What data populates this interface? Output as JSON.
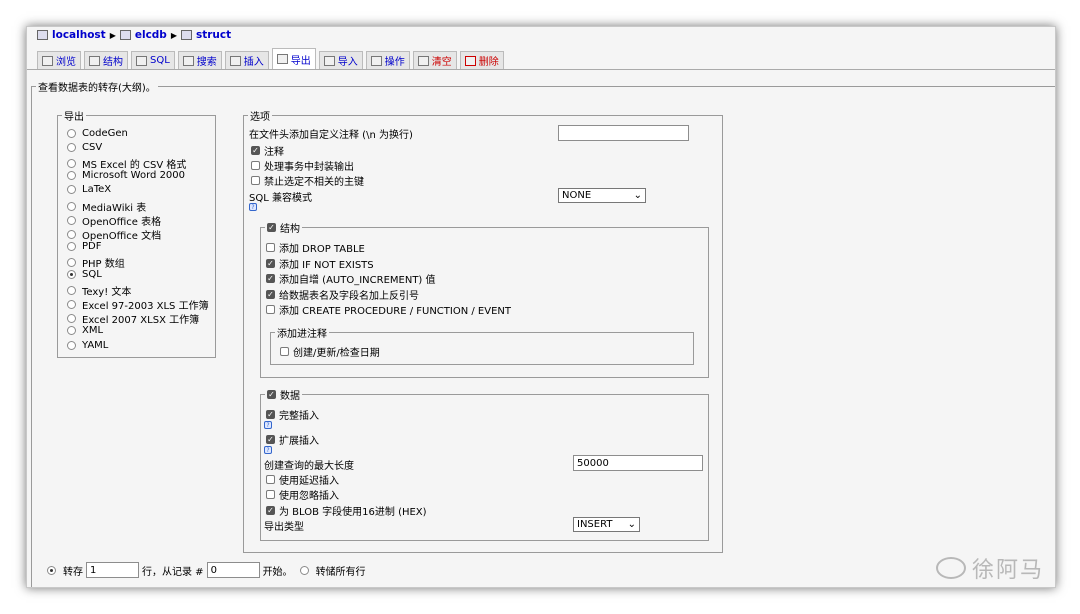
{
  "breadcrumb": {
    "server": "localhost",
    "database": "elcdb",
    "table": "struct"
  },
  "tabs": [
    {
      "label": "浏览",
      "icon": "browse-icon"
    },
    {
      "label": "结构",
      "icon": "structure-icon"
    },
    {
      "label": "SQL",
      "icon": "sql-icon"
    },
    {
      "label": "搜索",
      "icon": "search-icon"
    },
    {
      "label": "插入",
      "icon": "insert-icon"
    },
    {
      "label": "导出",
      "icon": "export-icon",
      "active": true
    },
    {
      "label": "导入",
      "icon": "import-icon"
    },
    {
      "label": "操作",
      "icon": "operations-icon"
    },
    {
      "label": "清空",
      "icon": "empty-icon"
    },
    {
      "label": "删除",
      "icon": "drop-icon"
    }
  ],
  "main_legend": "查看数据表的转存(大纲)。",
  "export": {
    "legend": "导出",
    "formats": [
      "CodeGen",
      "CSV",
      "MS Excel 的 CSV 格式",
      "Microsoft Word 2000",
      "LaTeX",
      "MediaWiki 表",
      "OpenOffice 表格",
      "OpenOffice 文档",
      "PDF",
      "PHP 数组",
      "SQL",
      "Texy! 文本",
      "Excel 97-2003 XLS 工作簿",
      "Excel 2007 XLSX 工作簿",
      "XML",
      "YAML"
    ],
    "selected": "SQL"
  },
  "options": {
    "legend": "选项",
    "header_comment_label": "在文件头添加自定义注释 (\\n 为换行)",
    "header_comment_value": "",
    "comments_label": "注释",
    "transaction_label": "处理事务中封装输出",
    "disable_fk_label": "禁止选定不相关的主键",
    "compat_label": "SQL 兼容模式",
    "compat_value": "NONE",
    "structure": {
      "legend": "结构",
      "drop_table": "添加 DROP TABLE",
      "if_not_exists": "添加 IF NOT EXISTS",
      "auto_increment": "添加自增 (AUTO_INCREMENT) 值",
      "backquotes": "给数据表名及字段名加上反引号",
      "create_procedure": "添加 CREATE PROCEDURE / FUNCTION / EVENT",
      "comments_legend": "添加进注释",
      "dates_label": "创建/更新/检查日期"
    },
    "data": {
      "legend": "数据",
      "complete_insert": "完整插入",
      "extended_insert": "扩展插入",
      "max_query_label": "创建查询的最大长度",
      "max_query_value": "50000",
      "delayed_insert": "使用延迟插入",
      "ignore_insert": "使用忽略插入",
      "hex_blob": "为 BLOB 字段使用16进制 (HEX)",
      "export_type_label": "导出类型",
      "export_type_value": "INSERT"
    }
  },
  "footer": {
    "dump_label": "转存",
    "rows_value": "1",
    "rows_from_label": "行，从记录 #",
    "start_value": "0",
    "start_label": "开始。",
    "dump_all_label": "转储所有行"
  },
  "watermark": "徐阿马"
}
